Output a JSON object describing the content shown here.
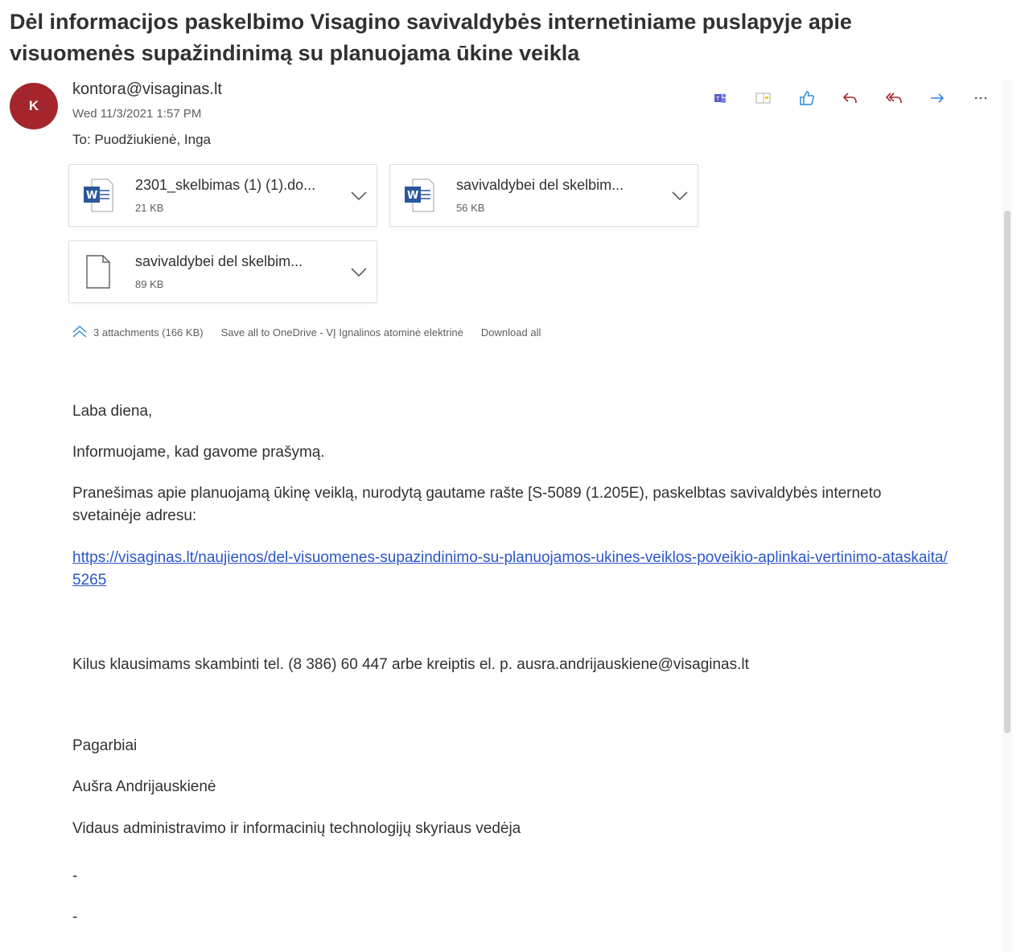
{
  "subject": "Dėl informacijos paskelbimo Visagino savivaldybės internetiniame puslapyje apie visuomenės supažindinimą su planuojama ūkine veikla",
  "sender": {
    "initial": "K",
    "email": "kontora@visaginas.lt",
    "date": "Wed 11/3/2021 1:57 PM",
    "to": "To:  Puodžiukienė, Inga",
    "avatar_color": "#a4262c"
  },
  "actions": [
    "teams-icon",
    "immersive-reader-icon",
    "like-icon",
    "reply-icon",
    "reply-all-icon",
    "forward-icon",
    "more-icon"
  ],
  "attachments": [
    {
      "name": "2301_skelbimas (1) (1).do...",
      "size": "21 KB",
      "type": "word"
    },
    {
      "name": "savivaldybei del skelbim...",
      "size": "56 KB",
      "type": "word"
    },
    {
      "name": "savivaldybei del skelbim...",
      "size": "89 KB",
      "type": "file"
    }
  ],
  "attachments_bar": {
    "summary": "3 attachments (166 KB)",
    "save": "Save all to OneDrive - VĮ Ignalinos atominė elektrinė",
    "download": "Download all"
  },
  "body": {
    "greeting": "Laba diena,",
    "p1": "Informuojame, kad gavome prašymą.",
    "p2": "Pranešimas apie planuojamą ūkinę veiklą, nurodytą gautame rašte [S-5089 (1.205E), paskelbtas savivaldybės interneto svetainėje adresu:",
    "link": "https://visaginas.lt/naujienos/del-visuomenes-supazindinimo-su-planuojamos-ukines-veiklos-poveikio-aplinkai-vertinimo-ataskaita/5265",
    "contact": "Kilus klausimams skambinti tel. (8 386) 60 447 arbe kreiptis el. p. ausra.andrijauskiene@visaginas.lt",
    "regards": "Pagarbiai",
    "name": "Aušra Andrijauskienė",
    "position": "Vidaus administravimo ir informacinių  technologijų skyriaus vedėja",
    "dash1": "-",
    "dash2": "-"
  },
  "colors": {
    "accent": "#2b55c9",
    "word": "#2b579a"
  }
}
